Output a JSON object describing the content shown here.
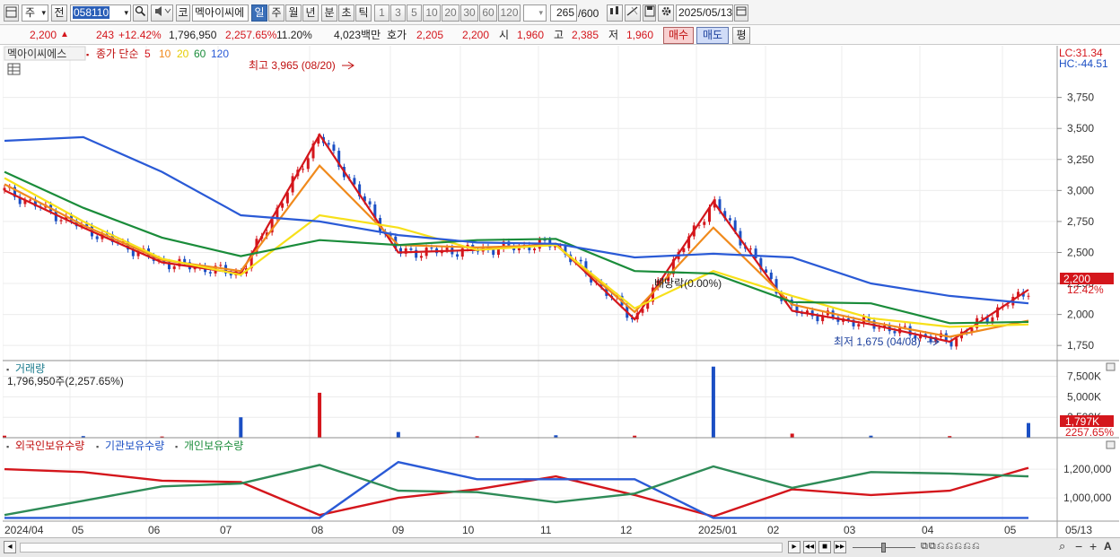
{
  "toolbar": {
    "period_label": "주",
    "prev_label": "전",
    "code_value": "058110",
    "stock_prefix": "코",
    "stock_name": "멕아이씨에",
    "periods": [
      "일",
      "주",
      "월",
      "년",
      "분",
      "초",
      "틱"
    ],
    "active_period": "일",
    "intervals": [
      "1",
      "3",
      "5",
      "10",
      "20",
      "30",
      "60",
      "120"
    ],
    "count_value": "265",
    "count_max": "/600",
    "date_value": "2025/05/13"
  },
  "quote": {
    "price": "2,200",
    "change": "243",
    "change_pct": "+12.42%",
    "volume": "1,796,950",
    "volume_pct": "2,257.65%",
    "turnover_rate": "11.20%",
    "amount": "4,023백만",
    "bid_label": "호가",
    "bid_value": "2,205",
    "open_value": "2,200",
    "open_label": "시",
    "open_price": "1,960",
    "high_label": "고",
    "high_price": "2,385",
    "low_label": "저",
    "low_price": "1,960",
    "buy_label": "매수",
    "sell_label": "매도",
    "eval_label": "평"
  },
  "price_chart": {
    "name": "멕아이씨에스",
    "ma_label": "종가 단순",
    "ma_periods": [
      "5",
      "10",
      "20",
      "60",
      "120"
    ],
    "lc": "LC:31.34",
    "hc": "HC:-44.51",
    "y_ticks": [
      "3,750",
      "3,500",
      "3,250",
      "3,000",
      "2,750",
      "2,500",
      "2,250",
      "2,000",
      "1,750"
    ],
    "high_annot": "최고 3,965 (08/20)",
    "low_annot": "최저 1,675 (04/08)",
    "dividend_annot": "배당락(0.00%)",
    "current_price": "2,200",
    "current_pct": "12.42%"
  },
  "volume_chart": {
    "title": "거래량",
    "value_label": "1,796,950주(2,257.65%)",
    "y_ticks": [
      "7,500K",
      "5,000K",
      "2,500K"
    ],
    "current": "1,797K",
    "current_pct": "2257.65%"
  },
  "holding_chart": {
    "series_labels": [
      "외국인보유수량",
      "기관보유수량",
      "개인보유수량"
    ],
    "y_ticks": [
      "1,200,000",
      "1,000,000"
    ]
  },
  "x_axis": {
    "labels": [
      "2024/04",
      "05",
      "06",
      "07",
      "08",
      "09",
      "10",
      "11",
      "12",
      "2025/01",
      "02",
      "03",
      "04",
      "05",
      "05/13"
    ]
  },
  "chart_data": [
    {
      "type": "line",
      "title": "멕아이씨에스",
      "ylim": [
        1650,
        3950
      ],
      "x": [
        "2024/04",
        "05",
        "06",
        "07",
        "08",
        "09",
        "10",
        "11",
        "12",
        "2025/01",
        "02",
        "03",
        "04",
        "05"
      ],
      "series": [
        {
          "name": "5",
          "color": "#d4161c",
          "values": [
            3000,
            2700,
            2420,
            2330,
            3450,
            2500,
            2520,
            2570,
            1960,
            2910,
            2030,
            1920,
            1780,
            2200
          ]
        },
        {
          "name": "10",
          "color": "#f08a1c",
          "values": [
            3050,
            2720,
            2440,
            2350,
            3200,
            2560,
            2540,
            2560,
            2020,
            2700,
            2080,
            1940,
            1820,
            1950
          ]
        },
        {
          "name": "20",
          "color": "#f7e01a",
          "values": [
            3100,
            2750,
            2450,
            2320,
            2800,
            2700,
            2520,
            2560,
            2050,
            2350,
            2150,
            1970,
            1900,
            1920
          ]
        },
        {
          "name": "60",
          "color": "#1a8c3a",
          "values": [
            3150,
            2860,
            2620,
            2470,
            2600,
            2560,
            2600,
            2610,
            2350,
            2330,
            2100,
            2090,
            1930,
            1940
          ]
        },
        {
          "name": "120",
          "color": "#2a5ad6",
          "values": [
            3400,
            3430,
            3150,
            2800,
            2750,
            2640,
            2580,
            2570,
            2460,
            2490,
            2460,
            2250,
            2150,
            2090
          ]
        }
      ]
    },
    {
      "type": "bar",
      "title": "거래량",
      "categories": [
        "2024/04",
        "05",
        "06",
        "07",
        "08",
        "09",
        "10",
        "11",
        "12",
        "2025/01",
        "02",
        "03",
        "04",
        "05"
      ],
      "values": [
        250,
        200,
        150,
        2500,
        5500,
        700,
        180,
        300,
        250,
        8700,
        500,
        250,
        200,
        1797
      ]
    },
    {
      "type": "line",
      "x": [
        "2024/04",
        "05",
        "06",
        "07",
        "08",
        "09",
        "10",
        "11",
        "12",
        "2025/01",
        "02",
        "03",
        "04",
        "05"
      ],
      "ylim": [
        850000,
        1320000
      ],
      "series": [
        {
          "name": "외국인보유수량",
          "color": "#d4161c",
          "values": [
            1200000,
            1180000,
            1120000,
            1110000,
            880000,
            1000000,
            1060000,
            1150000,
            1020000,
            870000,
            1060000,
            1020000,
            1050000,
            1210000
          ]
        },
        {
          "name": "기관보유수량",
          "color": "#2a5ad6",
          "values": [
            860000,
            860000,
            860000,
            860000,
            860000,
            1250000,
            1130000,
            1130000,
            1130000,
            860000,
            860000,
            860000,
            860000,
            860000
          ]
        },
        {
          "name": "개인보유수량",
          "color": "#2e8b57",
          "values": [
            880000,
            980000,
            1080000,
            1100000,
            1230000,
            1050000,
            1040000,
            970000,
            1030000,
            1220000,
            1070000,
            1180000,
            1170000,
            1150000
          ]
        }
      ]
    }
  ]
}
